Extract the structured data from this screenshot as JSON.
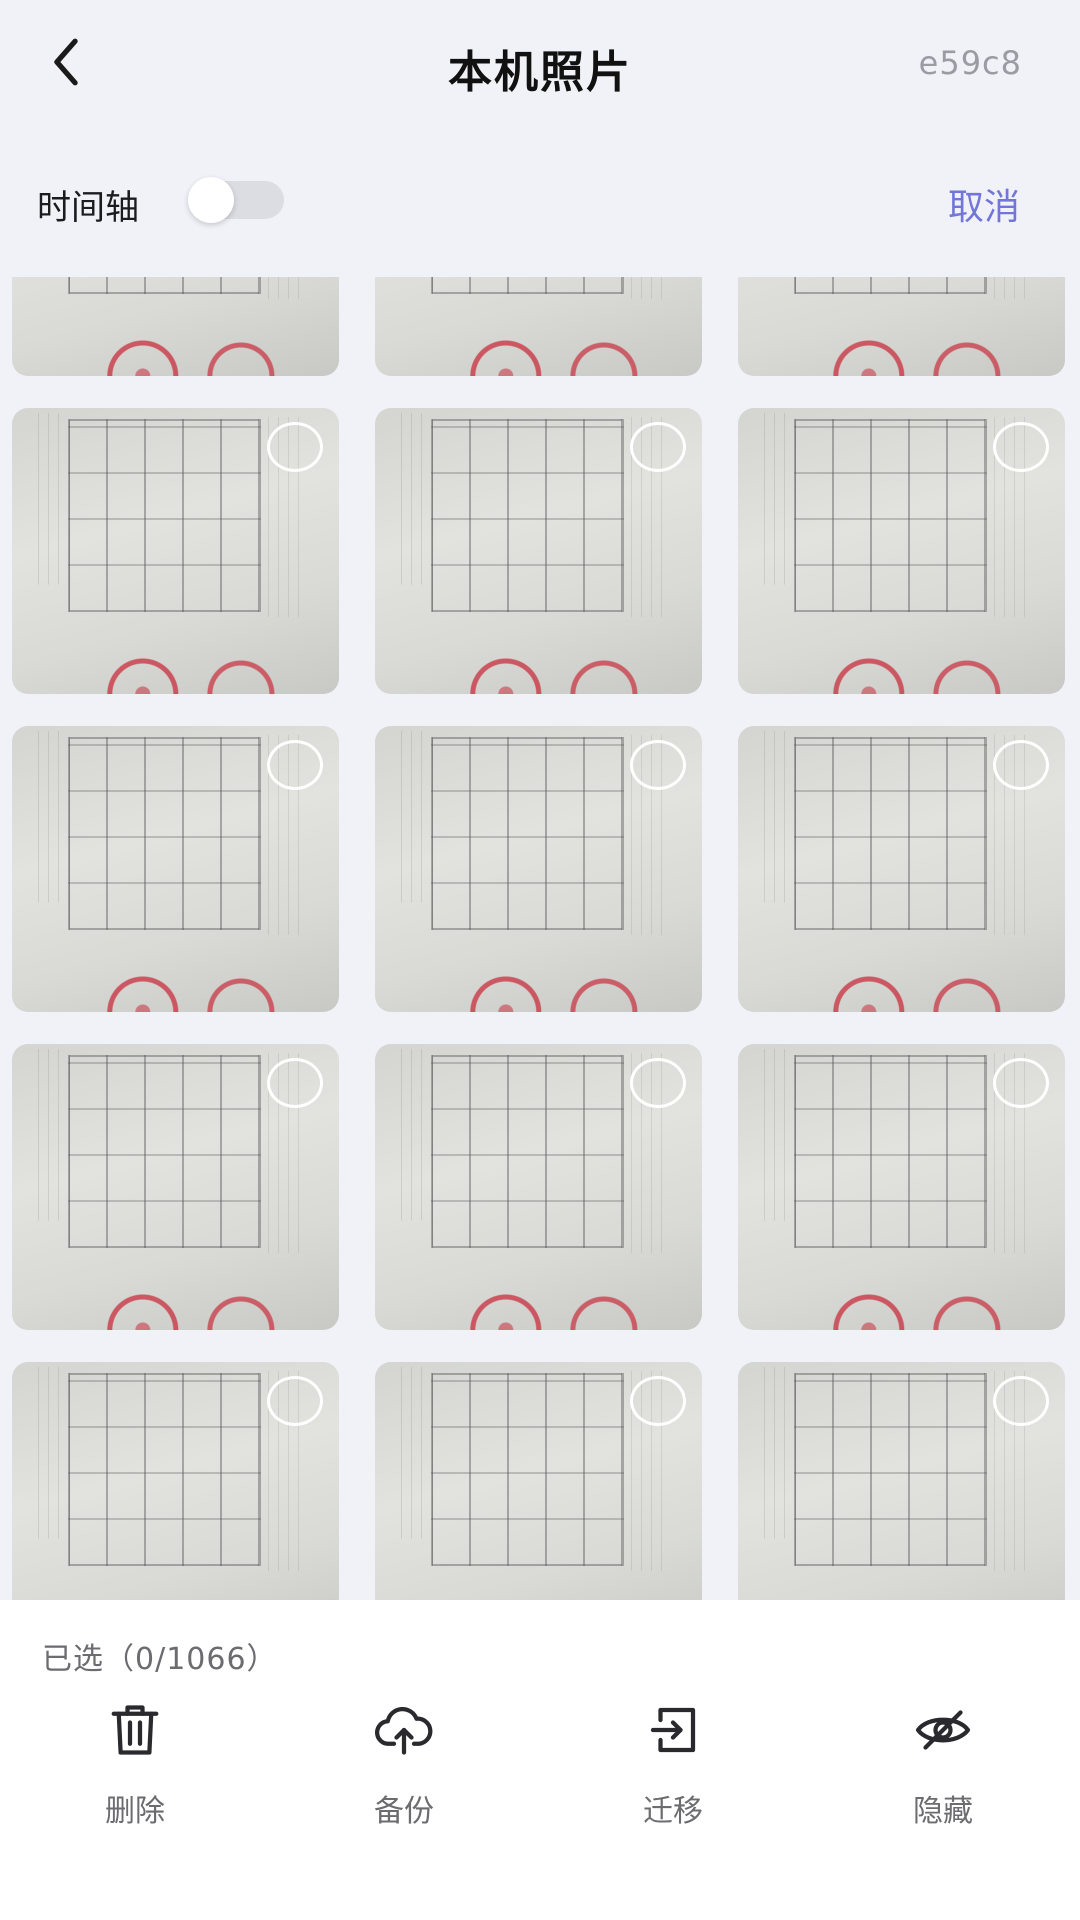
{
  "header": {
    "back_icon": "chevron-left-icon",
    "title": "本机照片",
    "device_id": "e59c8"
  },
  "toolbar": {
    "timeline_label": "时间轴",
    "timeline_enabled": false,
    "cancel_label": "取消"
  },
  "photo_grid": {
    "selection_indicator": "unchecked-circle-icon"
  },
  "selection": {
    "summary": "已选（0/1066）"
  },
  "actions": [
    {
      "label": "删除",
      "icon": "trash-icon"
    },
    {
      "label": "备份",
      "icon": "cloud-upload-icon"
    },
    {
      "label": "迁移",
      "icon": "transfer-icon"
    },
    {
      "label": "隐藏",
      "icon": "eye-off-icon"
    }
  ],
  "colors": {
    "background": "#f1f2f8",
    "accent": "#7276d8",
    "panel": "#ffffff",
    "toggle_track": "#dcdde3"
  }
}
